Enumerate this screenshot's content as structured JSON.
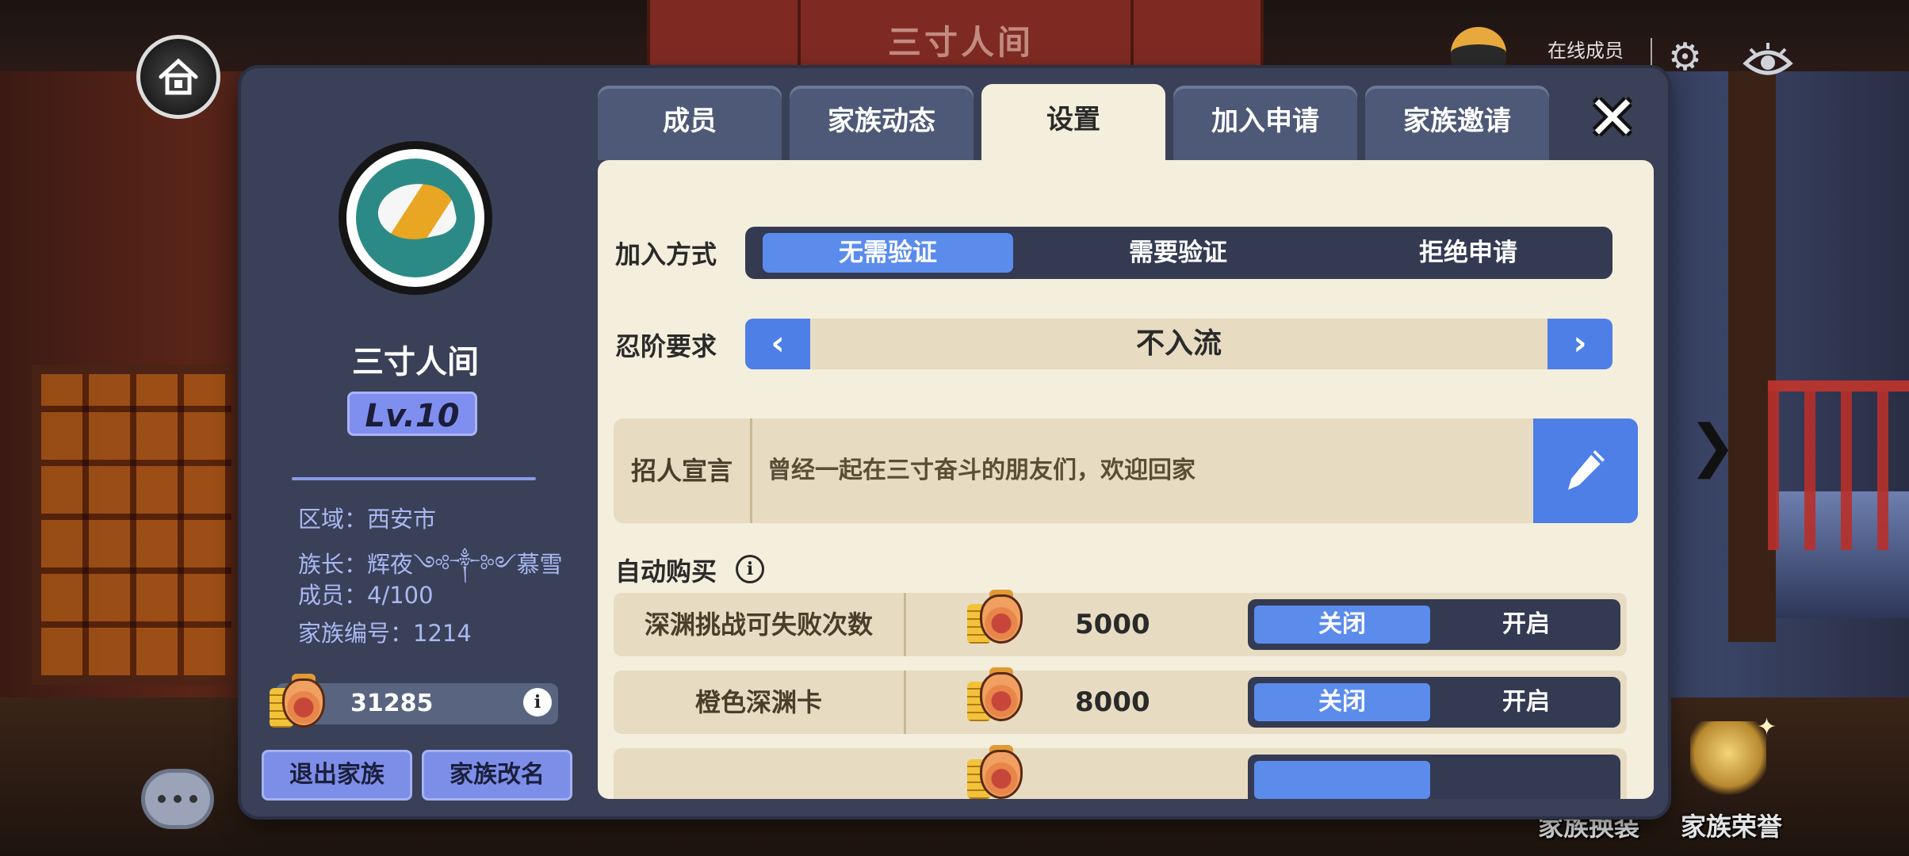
{
  "background": {
    "banner_title": "三寸人间"
  },
  "hud": {
    "online_label": "在线成员",
    "bottom_buttons": [
      {
        "label": "家族换装"
      },
      {
        "label": "家族荣誉"
      }
    ]
  },
  "family": {
    "name": "三寸人间",
    "level": "Lv.10",
    "info": [
      "区域：西安市",
      "族长：辉夜༺༒༻慕雪",
      "成员：4/100",
      "家族编号：1214"
    ],
    "coins": "31285",
    "buttons": {
      "quit": "退出家族",
      "rename": "家族改名"
    }
  },
  "tabs": [
    {
      "label": "成员",
      "active": false
    },
    {
      "label": "家族动态",
      "active": false
    },
    {
      "label": "设置",
      "active": true
    },
    {
      "label": "加入申请",
      "active": false
    },
    {
      "label": "家族邀请",
      "active": false
    }
  ],
  "settings": {
    "join_label": "加入方式",
    "join_options": [
      "无需验证",
      "需要验证",
      "拒绝申请"
    ],
    "join_selected": "无需验证",
    "rank_label": "忍阶要求",
    "rank_value": "不入流",
    "slogan_label": "招人宣言",
    "slogan_text": "曾经一起在三寸奋斗的朋友们，欢迎回家",
    "auto_buy_label": "自动购买",
    "toggle_off": "关闭",
    "toggle_on": "开启",
    "auto_buy_items": [
      {
        "name": "深渊挑战可失败次数",
        "price": "5000",
        "state": "关闭"
      },
      {
        "name": "橙色深渊卡",
        "price": "8000",
        "state": "关闭"
      }
    ]
  },
  "colors": {
    "panel_bg": "#3a4057",
    "content_bg": "#f4eedc",
    "accent_blue": "#5b8cec",
    "dark_segment": "#333a52",
    "level_badge": "#7f8ff0",
    "info_text": "#a9b8f2"
  },
  "icons": {
    "home": "home-icon",
    "chat": "chat-icon",
    "settings": "gear-icon",
    "view": "eye-icon",
    "close": "close-icon",
    "edit": "pencil-icon",
    "info": "info-icon",
    "currency": "coin-bag-icon"
  }
}
